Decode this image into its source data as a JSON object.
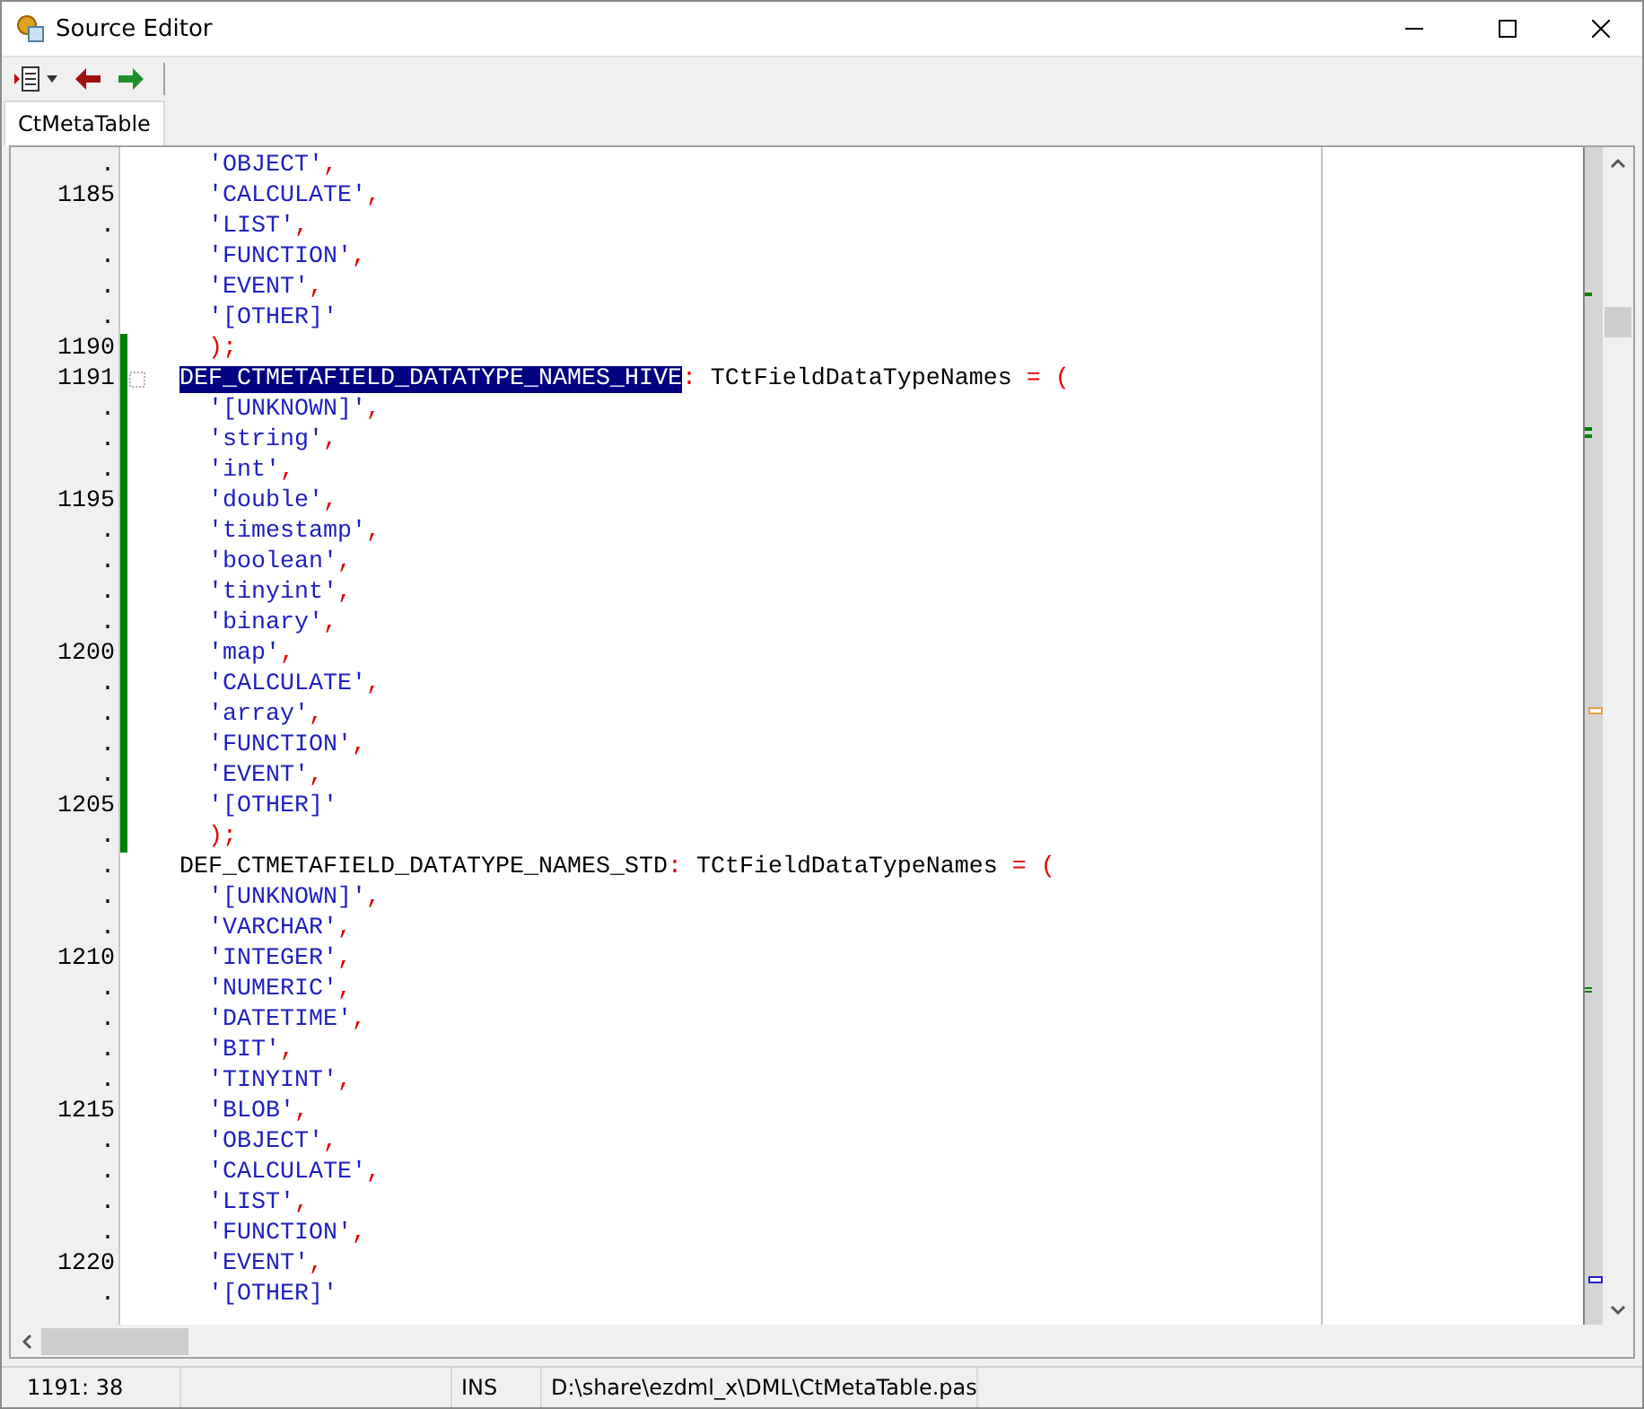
{
  "window": {
    "title": "Source Editor"
  },
  "tabs": [
    {
      "label": "CtMetaTable",
      "selected": true
    }
  ],
  "lines": [
    {
      "gutter": ".",
      "modified": false,
      "code": [
        {
          "kind": "string",
          "text": "    'OBJECT'"
        },
        {
          "kind": "symbol",
          "text": ","
        }
      ]
    },
    {
      "gutter": "1185",
      "modified": false,
      "code": [
        {
          "kind": "string",
          "text": "    'CALCULATE'"
        },
        {
          "kind": "symbol",
          "text": ","
        }
      ]
    },
    {
      "gutter": ".",
      "modified": false,
      "code": [
        {
          "kind": "string",
          "text": "    'LIST'"
        },
        {
          "kind": "symbol",
          "text": ","
        }
      ]
    },
    {
      "gutter": ".",
      "modified": false,
      "code": [
        {
          "kind": "string",
          "text": "    'FUNCTION'"
        },
        {
          "kind": "symbol",
          "text": ","
        }
      ]
    },
    {
      "gutter": ".",
      "modified": false,
      "code": [
        {
          "kind": "string",
          "text": "    'EVENT'"
        },
        {
          "kind": "symbol",
          "text": ","
        }
      ]
    },
    {
      "gutter": ".",
      "modified": false,
      "code": [
        {
          "kind": "string",
          "text": "    '[OTHER]'"
        }
      ]
    },
    {
      "gutter": "1190",
      "modified": true,
      "code": [
        {
          "kind": "symbol",
          "text": "    );"
        }
      ]
    },
    {
      "gutter": "1191",
      "modified": true,
      "fold": true,
      "code": [
        {
          "kind": "selection",
          "text": "DEF_CTMETAFIELD_DATATYPE_NAMES_HIVE"
        },
        {
          "kind": "symbol",
          "text": ":"
        },
        {
          "kind": "plain",
          "text": " TCtFieldDataTypeNames "
        },
        {
          "kind": "symbol",
          "text": "= ("
        }
      ]
    },
    {
      "gutter": ".",
      "modified": true,
      "code": [
        {
          "kind": "string",
          "text": "    '[UNKNOWN]'"
        },
        {
          "kind": "symbol",
          "text": ","
        }
      ]
    },
    {
      "gutter": ".",
      "modified": true,
      "code": [
        {
          "kind": "string",
          "text": "    'string'"
        },
        {
          "kind": "symbol",
          "text": ","
        }
      ]
    },
    {
      "gutter": ".",
      "modified": true,
      "code": [
        {
          "kind": "string",
          "text": "    'int'"
        },
        {
          "kind": "symbol",
          "text": ","
        }
      ]
    },
    {
      "gutter": "1195",
      "modified": true,
      "code": [
        {
          "kind": "string",
          "text": "    'double'"
        },
        {
          "kind": "symbol",
          "text": ","
        }
      ]
    },
    {
      "gutter": ".",
      "modified": true,
      "code": [
        {
          "kind": "string",
          "text": "    'timestamp'"
        },
        {
          "kind": "symbol",
          "text": ","
        }
      ]
    },
    {
      "gutter": ".",
      "modified": true,
      "code": [
        {
          "kind": "string",
          "text": "    'boolean'"
        },
        {
          "kind": "symbol",
          "text": ","
        }
      ]
    },
    {
      "gutter": ".",
      "modified": true,
      "code": [
        {
          "kind": "string",
          "text": "    'tinyint'"
        },
        {
          "kind": "symbol",
          "text": ","
        }
      ]
    },
    {
      "gutter": ".",
      "modified": true,
      "code": [
        {
          "kind": "string",
          "text": "    'binary'"
        },
        {
          "kind": "symbol",
          "text": ","
        }
      ]
    },
    {
      "gutter": "1200",
      "modified": true,
      "code": [
        {
          "kind": "string",
          "text": "    'map'"
        },
        {
          "kind": "symbol",
          "text": ","
        }
      ]
    },
    {
      "gutter": ".",
      "modified": true,
      "code": [
        {
          "kind": "string",
          "text": "    'CALCULATE'"
        },
        {
          "kind": "symbol",
          "text": ","
        }
      ]
    },
    {
      "gutter": ".",
      "modified": true,
      "code": [
        {
          "kind": "string",
          "text": "    'array'"
        },
        {
          "kind": "symbol",
          "text": ","
        }
      ]
    },
    {
      "gutter": ".",
      "modified": true,
      "code": [
        {
          "kind": "string",
          "text": "    'FUNCTION'"
        },
        {
          "kind": "symbol",
          "text": ","
        }
      ]
    },
    {
      "gutter": ".",
      "modified": true,
      "code": [
        {
          "kind": "string",
          "text": "    'EVENT'"
        },
        {
          "kind": "symbol",
          "text": ","
        }
      ]
    },
    {
      "gutter": "1205",
      "modified": true,
      "code": [
        {
          "kind": "string",
          "text": "    '[OTHER]'"
        }
      ]
    },
    {
      "gutter": ".",
      "modified": true,
      "code": [
        {
          "kind": "symbol",
          "text": "    );"
        }
      ]
    },
    {
      "gutter": ".",
      "modified": false,
      "code": [
        {
          "kind": "plain",
          "text": "DEF_CTMETAFIELD_DATATYPE_NAMES_STD"
        },
        {
          "kind": "symbol",
          "text": ":"
        },
        {
          "kind": "plain",
          "text": " TCtFieldDataTypeNames "
        },
        {
          "kind": "symbol",
          "text": "= ("
        }
      ]
    },
    {
      "gutter": ".",
      "modified": false,
      "code": [
        {
          "kind": "string",
          "text": "    '[UNKNOWN]'"
        },
        {
          "kind": "symbol",
          "text": ","
        }
      ]
    },
    {
      "gutter": ".",
      "modified": false,
      "code": [
        {
          "kind": "string",
          "text": "    'VARCHAR'"
        },
        {
          "kind": "symbol",
          "text": ","
        }
      ]
    },
    {
      "gutter": "1210",
      "modified": false,
      "code": [
        {
          "kind": "string",
          "text": "    'INTEGER'"
        },
        {
          "kind": "symbol",
          "text": ","
        }
      ]
    },
    {
      "gutter": ".",
      "modified": false,
      "code": [
        {
          "kind": "string",
          "text": "    'NUMERIC'"
        },
        {
          "kind": "symbol",
          "text": ","
        }
      ]
    },
    {
      "gutter": ".",
      "modified": false,
      "code": [
        {
          "kind": "string",
          "text": "    'DATETIME'"
        },
        {
          "kind": "symbol",
          "text": ","
        }
      ]
    },
    {
      "gutter": ".",
      "modified": false,
      "code": [
        {
          "kind": "string",
          "text": "    'BIT'"
        },
        {
          "kind": "symbol",
          "text": ","
        }
      ]
    },
    {
      "gutter": ".",
      "modified": false,
      "code": [
        {
          "kind": "string",
          "text": "    'TINYINT'"
        },
        {
          "kind": "symbol",
          "text": ","
        }
      ]
    },
    {
      "gutter": "1215",
      "modified": false,
      "code": [
        {
          "kind": "string",
          "text": "    'BLOB'"
        },
        {
          "kind": "symbol",
          "text": ","
        }
      ]
    },
    {
      "gutter": ".",
      "modified": false,
      "code": [
        {
          "kind": "string",
          "text": "    'OBJECT'"
        },
        {
          "kind": "symbol",
          "text": ","
        }
      ]
    },
    {
      "gutter": ".",
      "modified": false,
      "code": [
        {
          "kind": "string",
          "text": "    'CALCULATE'"
        },
        {
          "kind": "symbol",
          "text": ","
        }
      ]
    },
    {
      "gutter": ".",
      "modified": false,
      "code": [
        {
          "kind": "string",
          "text": "    'LIST'"
        },
        {
          "kind": "symbol",
          "text": ","
        }
      ]
    },
    {
      "gutter": ".",
      "modified": false,
      "code": [
        {
          "kind": "string",
          "text": "    'FUNCTION'"
        },
        {
          "kind": "symbol",
          "text": ","
        }
      ]
    },
    {
      "gutter": "1220",
      "modified": false,
      "code": [
        {
          "kind": "string",
          "text": "    'EVENT'"
        },
        {
          "kind": "symbol",
          "text": ","
        }
      ]
    },
    {
      "gutter": ".",
      "modified": false,
      "code": [
        {
          "kind": "string",
          "text": "    '[OTHER]'"
        }
      ]
    }
  ],
  "status_bar": {
    "position": "1191: 38",
    "mode": "INS",
    "file": "D:\\share\\ezdml_x\\DML\\CtMetaTable.pas"
  }
}
